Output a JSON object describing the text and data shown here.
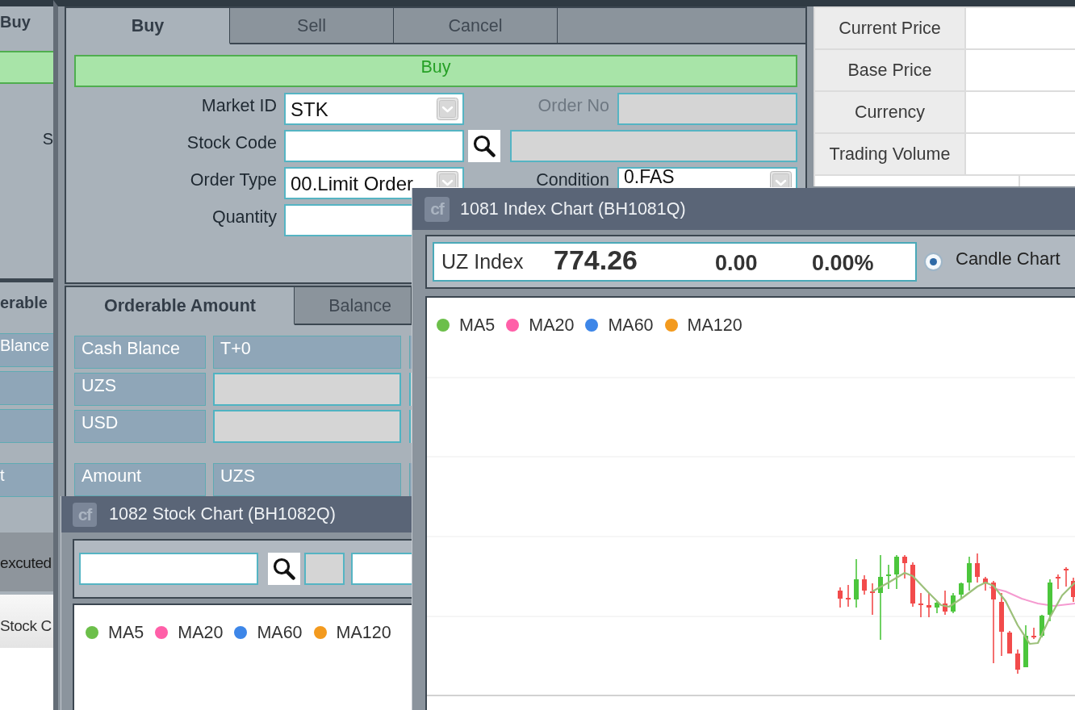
{
  "background_window": {
    "tab": "Buy",
    "field_label": "S",
    "section_tab": "erable",
    "rows": [
      {
        "kind": "header",
        "text": "Blance"
      },
      {
        "kind": "value"
      },
      {
        "kind": "value"
      },
      {
        "kind": "header",
        "text": "t"
      }
    ],
    "status_label": "excuted",
    "bottom_tab": "Stock C"
  },
  "main_window": {
    "order_panel": {
      "tabs": [
        {
          "label": "Buy",
          "selected": true
        },
        {
          "label": "Sell",
          "selected": false
        },
        {
          "label": "Cancel",
          "selected": false
        }
      ],
      "action_bar": "Buy",
      "rows": [
        {
          "left": {
            "label": "Market ID",
            "kind": "select",
            "value": "STK",
            "disabled": false
          },
          "right": {
            "label": "Order No",
            "kind": "readonly",
            "disabled": true
          }
        },
        {
          "left": {
            "label": "Stock Code",
            "kind": "search",
            "disabled": false
          },
          "right": {
            "kind": "readonly"
          }
        },
        {
          "left": {
            "label": "Order Type",
            "kind": "select",
            "value": "00.Limit Order",
            "disabled": false
          },
          "right": {
            "label": "Condition",
            "kind": "select",
            "value": "0.FAS",
            "disabled": false
          }
        },
        {
          "left": {
            "label": "Quantity",
            "kind": "input",
            "disabled": false
          }
        }
      ]
    },
    "balance_panel": {
      "tabs": [
        {
          "label": "Orderable Amount",
          "selected": true
        },
        {
          "label": "Balance",
          "selected": false
        }
      ],
      "rows": [
        {
          "kind": "header",
          "cells": [
            "Cash Blance",
            "T+0"
          ]
        },
        {
          "kind": "value",
          "label": "UZS"
        },
        {
          "kind": "value",
          "label": "USD"
        },
        {
          "kind": "header",
          "cells": [
            "Amount",
            "UZS"
          ]
        }
      ]
    },
    "info_table": {
      "rows": [
        "Current Price",
        "Base Price",
        "Currency",
        "Trading Volume"
      ]
    }
  },
  "stock_chart_window": {
    "logo": "cf",
    "title": "1082 Stock Chart (BH1082Q)",
    "legend": [
      {
        "label": "MA5",
        "color": "#6cbf4a"
      },
      {
        "label": "MA20",
        "color": "#ff5fa8"
      },
      {
        "label": "MA60",
        "color": "#3d86e8"
      },
      {
        "label": "MA120",
        "color": "#f39a1e"
      }
    ]
  },
  "index_chart_window": {
    "logo": "cf",
    "title": "1081 Index Chart (BH1081Q)",
    "quote": {
      "name": "UZ Index",
      "price": "774.26",
      "change": "0.00",
      "change_rate": "0.00%"
    },
    "chart_types": [
      {
        "label": "Candle Chart",
        "selected": true
      }
    ],
    "legend": [
      {
        "label": "MA5",
        "color": "#6cbf4a"
      },
      {
        "label": "MA20",
        "color": "#ff5fa8"
      },
      {
        "label": "MA60",
        "color": "#3d86e8"
      },
      {
        "label": "MA120",
        "color": "#f39a1e"
      }
    ]
  }
}
